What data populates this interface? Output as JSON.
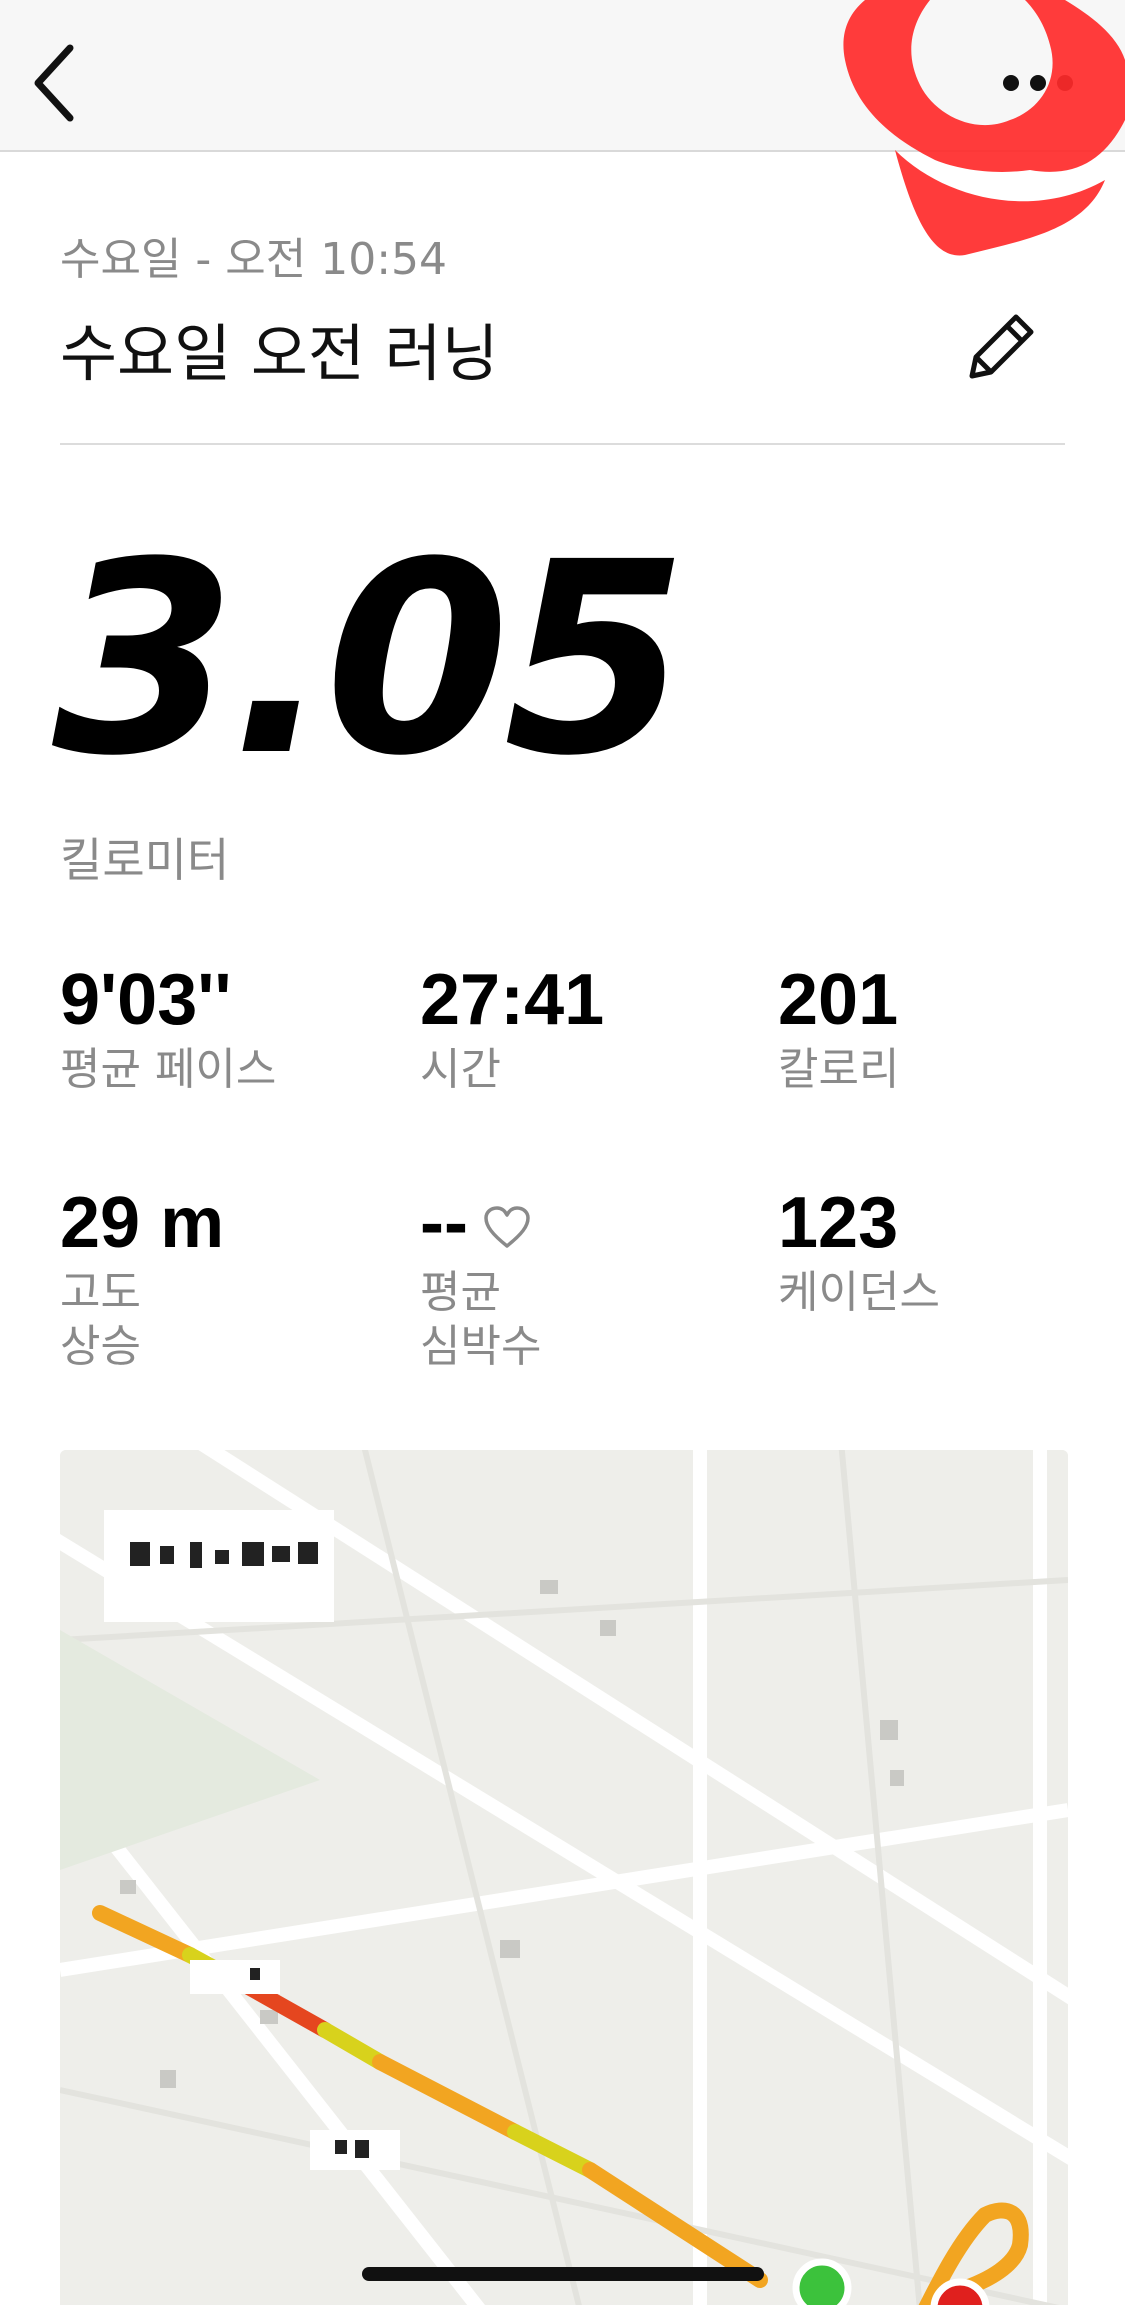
{
  "nav": {
    "back_icon": "chevron-left-icon",
    "more_icon": "more-horizontal-icon"
  },
  "header": {
    "date_time": "수요일 - 오전 10:54",
    "title": "수요일 오전 러닝",
    "edit_icon": "pencil-icon"
  },
  "distance": {
    "value": "3.05",
    "unit": "킬로미터"
  },
  "stats": {
    "pace": {
      "value": "9'03''",
      "label": "평균 페이스"
    },
    "time": {
      "value": "27:41",
      "label": "시간"
    },
    "calories": {
      "value": "201",
      "label": "칼로리"
    },
    "elevation": {
      "value": "29 m",
      "label_line1": "고도",
      "label_line2": "상승"
    },
    "heart_rate": {
      "value": "--",
      "label_line1": "평균",
      "label_line2": "심박수",
      "icon": "heart-icon"
    },
    "cadence": {
      "value": "123",
      "label": "케이던스"
    }
  },
  "colors": {
    "route_primary": "#f2a521",
    "route_fast": "#d8d21c",
    "route_slow": "#e5461f",
    "start_marker": "#3cc23c",
    "end_marker": "#e0201e",
    "annotation": "#ff2a2a"
  }
}
